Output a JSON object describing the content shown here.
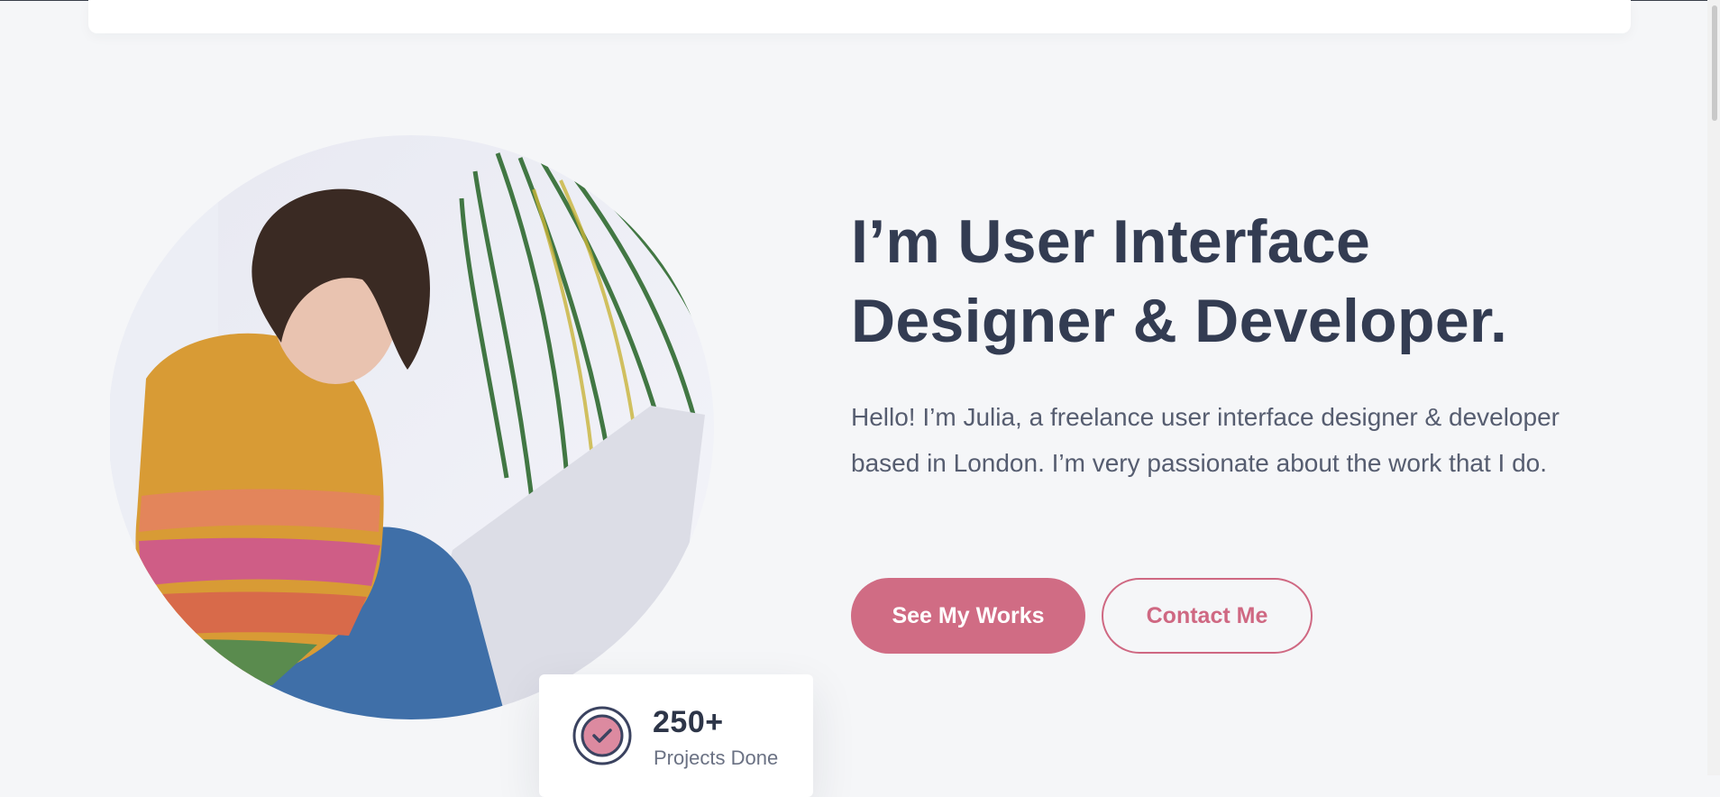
{
  "hero": {
    "title_line1": "I’m User Interface",
    "title_line2": "Designer & Developer.",
    "description": "Hello! I’m Julia, a freelance user interface designer & developer based in London. I’m very passionate about the work that I do.",
    "image_subject": "woman in striped sweater reading paper beside a plant"
  },
  "stat": {
    "number": "250+",
    "label": "Projects Done",
    "icon": "check-badge-icon"
  },
  "buttons": {
    "primary_label": "See My Works",
    "secondary_label": "Contact Me"
  },
  "colors": {
    "accent": "#d06c84",
    "heading": "#333c52",
    "body_text": "#565d70",
    "background": "#f5f6f8",
    "card": "#ffffff"
  }
}
